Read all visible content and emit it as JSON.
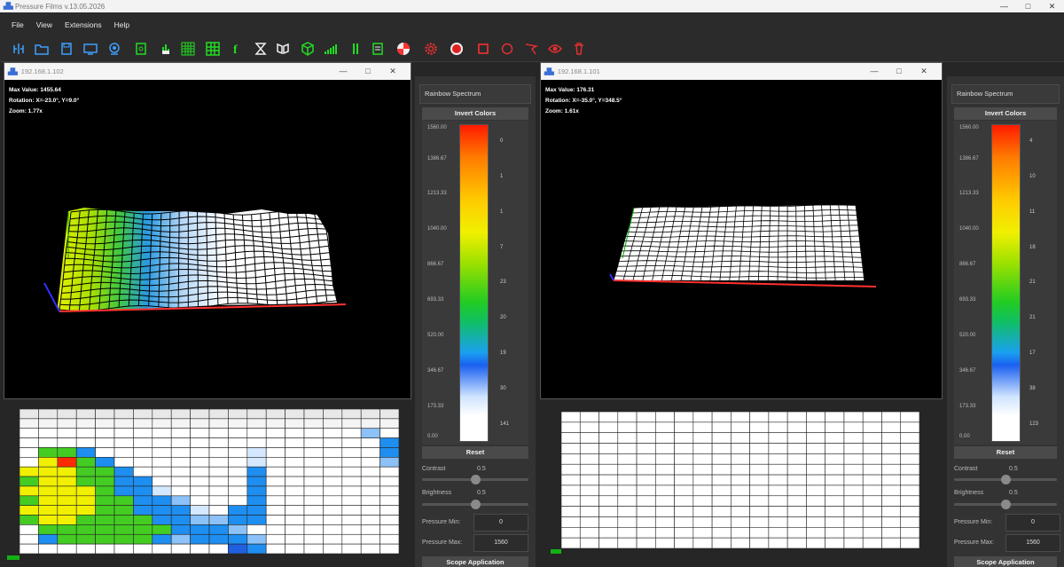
{
  "app": {
    "title": "Pressure Films v.13.05.2026"
  },
  "menu": [
    "File",
    "View",
    "Extensions",
    "Help"
  ],
  "window_controls": [
    "—",
    "□",
    "✕"
  ],
  "toolbar_icons": [
    {
      "name": "compare-icon",
      "color": "#3da0ff"
    },
    {
      "name": "open-folder-icon",
      "color": "#3da0ff"
    },
    {
      "name": "save-icon",
      "color": "#3da0ff"
    },
    {
      "name": "monitor-icon",
      "color": "#3da0ff"
    },
    {
      "name": "webcam-icon",
      "color": "#3da0ff"
    },
    {
      "name": "device-icon",
      "color": "#22dd22"
    },
    {
      "name": "sensor-icon",
      "color": "#22dd22"
    },
    {
      "name": "grid-icon",
      "color": "#22dd22"
    },
    {
      "name": "grid-dots-icon",
      "color": "#22dd22"
    },
    {
      "name": "function-icon",
      "color": "#22dd22"
    },
    {
      "name": "hourglass-icon",
      "color": "#eeeeee"
    },
    {
      "name": "mirror-icon",
      "color": "#eeeeee"
    },
    {
      "name": "cube-icon",
      "color": "#22dd22"
    },
    {
      "name": "signal-bars-icon",
      "color": "#22dd22"
    },
    {
      "name": "bar-icon",
      "color": "#22dd22"
    },
    {
      "name": "report-icon",
      "color": "#22dd22"
    },
    {
      "name": "target-icon",
      "color": "#ff3030"
    },
    {
      "name": "gear-icon",
      "color": "#e03030"
    },
    {
      "name": "record-icon",
      "color": "#e02020"
    },
    {
      "name": "crop-icon",
      "color": "#e03030"
    },
    {
      "name": "circle-icon",
      "color": "#e03030"
    },
    {
      "name": "lasso-icon",
      "color": "#e03030"
    },
    {
      "name": "eye-icon",
      "color": "#e03030"
    },
    {
      "name": "trash-icon",
      "color": "#e03030"
    }
  ],
  "windows": [
    {
      "title": "192.168.1.102",
      "max_value": "Max Value: 1455.64",
      "rotation": "Rotation: X=-23.0°, Y=9.0°",
      "zoom": "Zoom: 1.77x",
      "panel": {
        "colormap": "Rainbow Spectrum",
        "invert": "Invert Colors",
        "scale": [
          "1560.00",
          "1386.67",
          "1213.33",
          "1040.00",
          "866.67",
          "693.33",
          "520.00",
          "346.67",
          "173.33",
          "0.00"
        ],
        "counts": [
          "0",
          "1",
          "1",
          "7",
          "23",
          "20",
          "19",
          "30",
          "141"
        ],
        "reset": "Reset",
        "contrast_label": "Contrast",
        "contrast_value": "0.5",
        "contrast_level": 0.5,
        "brightness_label": "Brightness",
        "brightness_value": "0.5",
        "brightness_level": 0.5,
        "pmin_label": "Pressure Min:",
        "pmin_value": "0",
        "pmax_label": "Pressure Max:",
        "pmax_value": "1560",
        "scope": "Scope Application"
      }
    },
    {
      "title": "192.168.1.101",
      "max_value": "Max Value: 176.31",
      "rotation": "Rotation: X=-35.0°, Y=348.5°",
      "zoom": "Zoom: 1.61x",
      "panel": {
        "colormap": "Rainbow Spectrum",
        "invert": "Invert Colors",
        "scale": [
          "1560.00",
          "1386.67",
          "1213.33",
          "1040.00",
          "866.67",
          "693.33",
          "520.00",
          "346.67",
          "173.33",
          "0.00"
        ],
        "counts": [
          "4",
          "10",
          "11",
          "18",
          "21",
          "21",
          "17",
          "38",
          "123"
        ],
        "reset": "Reset",
        "contrast_label": "Contrast",
        "contrast_value": "0.5",
        "contrast_level": 0.5,
        "brightness_label": "Brightness",
        "brightness_value": "0.5",
        "brightness_level": 0.5,
        "pmin_label": "Pressure Min:",
        "pmin_value": "0",
        "pmax_label": "Pressure Max:",
        "pmax_value": "1560",
        "scope": "Scope Application"
      }
    }
  ]
}
